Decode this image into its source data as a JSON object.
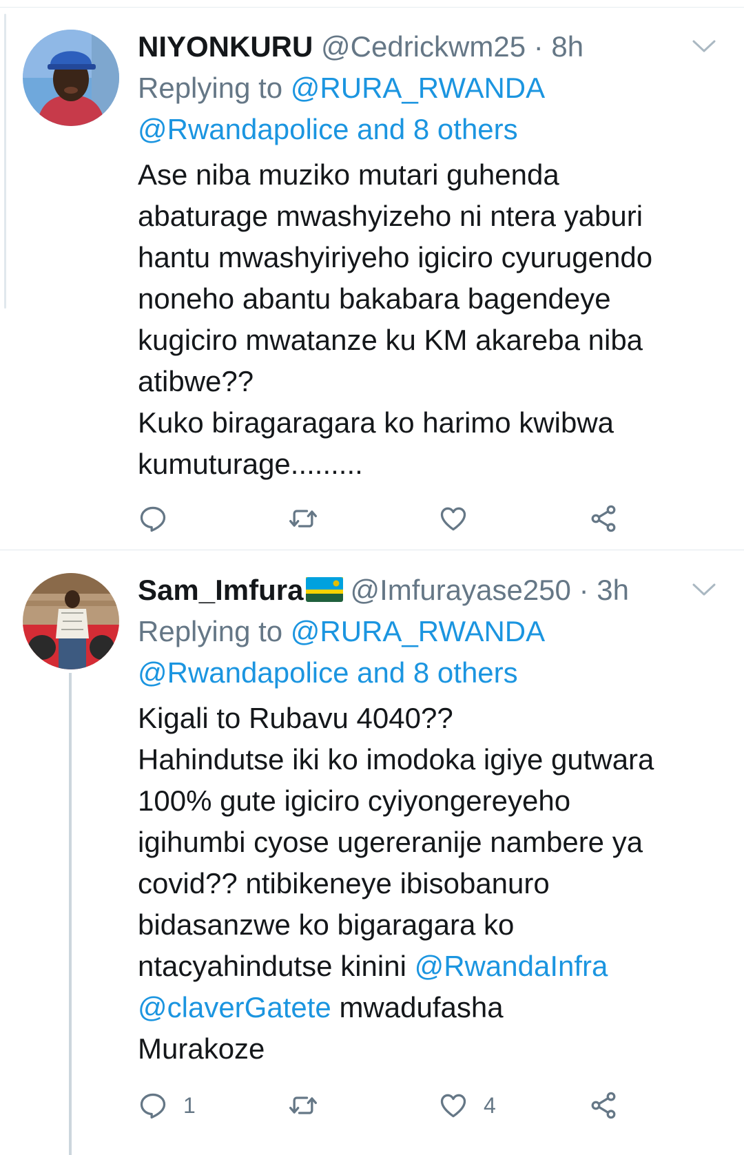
{
  "tweets": [
    {
      "display_name": "NIYONKURU",
      "handle": "@Cedrickwm25",
      "separator": "·",
      "time": "8h",
      "reply_prefix": "Replying to",
      "reply_mention_1": "@RURA_RWANDA",
      "reply_mention_2": "@Rwandapolice",
      "reply_and": "and",
      "reply_others": "8 others",
      "body_lines": [
        "Ase niba muziko mutari guhenda",
        "abaturage mwashyizeho ni ntera yaburi",
        "hantu mwashyiriyeho igiciro cyurugendo",
        "noneho abantu bakabara bagendeye",
        "kugiciro mwatanze ku KM akareba niba",
        "atibwe??",
        "Kuko biragaragara ko harimo kwibwa",
        "kumuturage........."
      ],
      "actions": {
        "reply_icon": "reply-icon",
        "retweet_icon": "retweet-icon",
        "like_icon": "heart-icon",
        "share_icon": "share-icon",
        "reply_count": "",
        "like_count": ""
      }
    },
    {
      "display_name": "Sam_Imfura",
      "flag": "rwanda-flag",
      "handle": "@Imfurayase250",
      "separator": "·",
      "time": "3h",
      "reply_prefix": "Replying to",
      "reply_mention_1": "@RURA_RWANDA",
      "reply_mention_2": "@Rwandapolice",
      "reply_and": "and",
      "reply_others": "8 others",
      "body_lines": [
        "Kigali to Rubavu 4040??",
        "Hahindutse iki ko imodoka igiye gutwara",
        "100% gute igiciro cyiyongereyeho",
        "igihumbi cyose ugereranije nambere ya",
        "covid??  ntibikeneye ibisobanuro",
        "bidasanzwe ko bigaragara ko"
      ],
      "body_line_7_text": "ntacyahindutse kinini",
      "body_line_7_mention": "@RwandaInfra",
      "body_line_8_mention": "@claverGatete",
      "body_line_8_text": "mwadufasha",
      "body_line_9": "Murakoze",
      "actions": {
        "reply_icon": "reply-icon",
        "retweet_icon": "retweet-icon",
        "like_icon": "heart-icon",
        "share_icon": "share-icon",
        "reply_count": "1",
        "like_count": "4"
      }
    }
  ],
  "colors": {
    "link": "#1b95e0",
    "secondary_text": "#657786",
    "primary_text": "#14171a",
    "divider": "#e1e8ed"
  }
}
